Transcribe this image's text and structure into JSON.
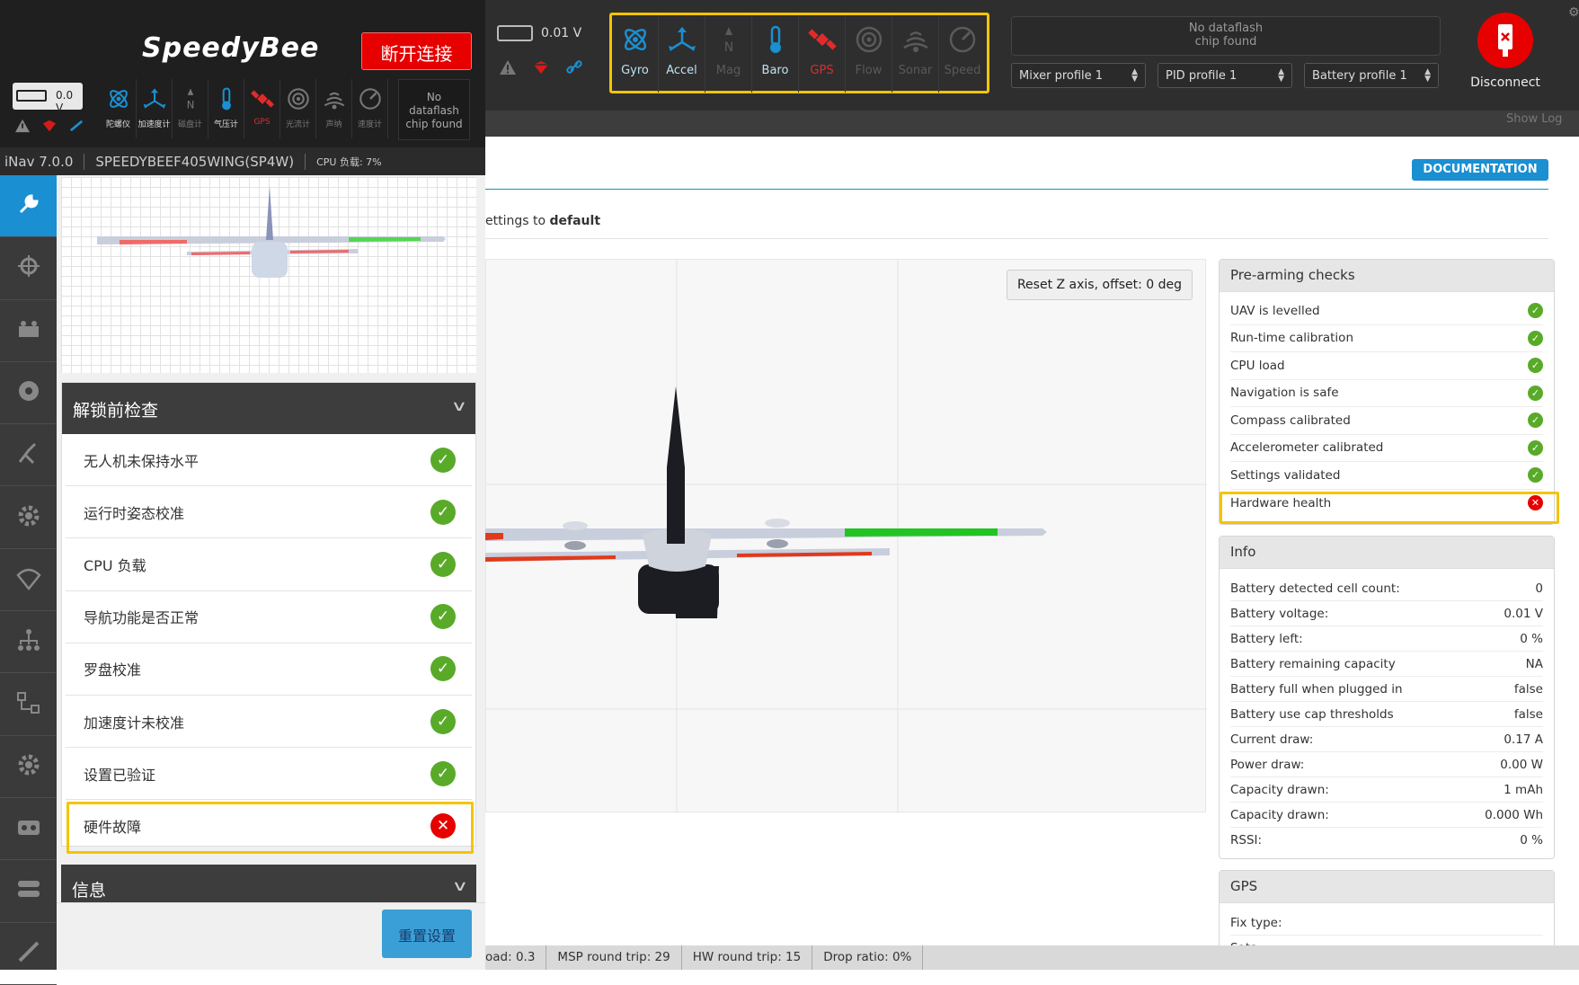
{
  "en": {
    "battery_voltage": "0.01 V",
    "sensors": [
      {
        "label": "Gyro",
        "icon": "gyro-icon",
        "state": "on"
      },
      {
        "label": "Accel",
        "icon": "accel-icon",
        "state": "on"
      },
      {
        "label": "Mag",
        "icon": "mag-icon",
        "state": "off"
      },
      {
        "label": "Baro",
        "icon": "baro-icon",
        "state": "on"
      },
      {
        "label": "GPS",
        "icon": "gps-icon",
        "state": "err"
      },
      {
        "label": "Flow",
        "icon": "flow-icon",
        "state": "off"
      },
      {
        "label": "Sonar",
        "icon": "sonar-icon",
        "state": "off"
      },
      {
        "label": "Speed",
        "icon": "speed-icon",
        "state": "off"
      }
    ],
    "dataflash_line1": "No dataflash",
    "dataflash_line2": "chip found",
    "mixer_profile": "Mixer profile 1",
    "pid_profile": "PID profile 1",
    "battery_profile": "Battery profile 1",
    "disconnect_label": "Disconnect",
    "show_log": "Show Log",
    "documentation": "DOCUMENTATION",
    "reset_text_prefix": "ettings to ",
    "reset_text_bold": "default",
    "reset_z": "Reset Z axis, offset: 0 deg",
    "prearm_title": "Pre-arming checks",
    "prearm": [
      {
        "label": "UAV is levelled",
        "ok": true
      },
      {
        "label": "Run-time calibration",
        "ok": true
      },
      {
        "label": "CPU load",
        "ok": true
      },
      {
        "label": "Navigation is safe",
        "ok": true
      },
      {
        "label": "Compass calibrated",
        "ok": true
      },
      {
        "label": "Accelerometer calibrated",
        "ok": true
      },
      {
        "label": "Settings validated",
        "ok": true
      },
      {
        "label": "Hardware health",
        "ok": false
      }
    ],
    "info_title": "Info",
    "info": [
      {
        "label": "Battery detected cell count:",
        "value": "0"
      },
      {
        "label": "Battery voltage:",
        "value": "0.01 V"
      },
      {
        "label": "Battery left:",
        "value": "0 %"
      },
      {
        "label": "Battery remaining capacity",
        "value": "NA"
      },
      {
        "label": "Battery full when plugged in",
        "value": "false"
      },
      {
        "label": "Battery use cap thresholds",
        "value": "false"
      },
      {
        "label": "Current draw:",
        "value": "0.17 A"
      },
      {
        "label": "Power draw:",
        "value": "0.00 W"
      },
      {
        "label": "Capacity drawn:",
        "value": "1 mAh"
      },
      {
        "label": "Capacity drawn:",
        "value": "0.000 Wh"
      },
      {
        "label": "RSSI:",
        "value": "0 %"
      }
    ],
    "gps_title": "GPS",
    "gps_fix_type": "Fix type:",
    "gps_sats": "Sats:",
    "status": {
      "load": "oad: 0.3",
      "msp": "MSP round trip: 29",
      "hw": "HW round trip: 15",
      "drop": "Drop ratio: 0%"
    }
  },
  "cn": {
    "logo": "SpeedyBee",
    "disconnect": "断开连接",
    "battery_voltage": "0.0 V",
    "sensors": [
      {
        "label": "陀螺仪",
        "icon": "gyro-icon",
        "state": "on"
      },
      {
        "label": "加速度计",
        "icon": "accel-icon",
        "state": "on"
      },
      {
        "label": "磁盘计",
        "icon": "mag-icon",
        "state": "off"
      },
      {
        "label": "气压计",
        "icon": "baro-icon",
        "state": "on"
      },
      {
        "label": "GPS",
        "icon": "gps-icon",
        "state": "err"
      },
      {
        "label": "光流计",
        "icon": "flow-icon",
        "state": "off"
      },
      {
        "label": "声纳",
        "icon": "sonar-icon",
        "state": "off"
      },
      {
        "label": "速度计",
        "icon": "speed-icon",
        "state": "off"
      }
    ],
    "dataflash_l1": "No",
    "dataflash_l2": "dataflash",
    "dataflash_l3": "chip found",
    "version": "iNav 7.0.0",
    "board": "SPEEDYBEEF405WING(SP4W)",
    "cpu": "CPU 负载: 7%",
    "prearm_title": "解锁前检查",
    "prearm": [
      {
        "label": "无人机未保持水平",
        "ok": true
      },
      {
        "label": "运行时姿态校准",
        "ok": true
      },
      {
        "label": "CPU 负载",
        "ok": true
      },
      {
        "label": "导航功能是否正常",
        "ok": true
      },
      {
        "label": "罗盘校准",
        "ok": true
      },
      {
        "label": "加速度计未校准",
        "ok": true
      },
      {
        "label": "设置已验证",
        "ok": true
      },
      {
        "label": "硬件故障",
        "ok": false
      }
    ],
    "info_title": "信息",
    "reset_button": "重置设置"
  },
  "colors": {
    "highlight": "#f5c400",
    "ok": "#59aa29",
    "error": "#e60000",
    "accent": "#1a8fd1"
  }
}
